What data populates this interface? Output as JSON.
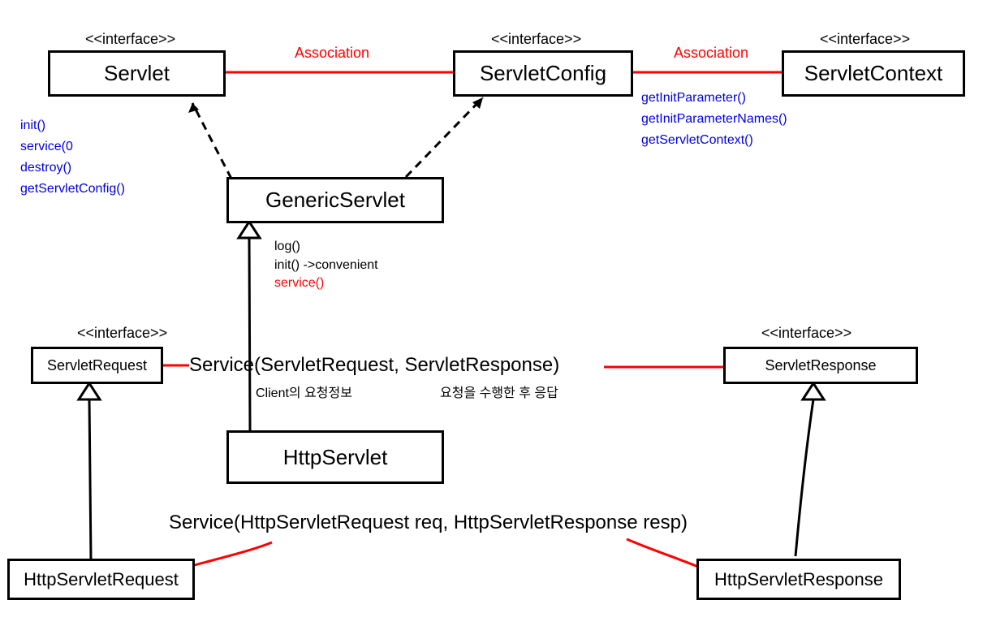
{
  "stereotypes": {
    "servlet": "<<interface>>",
    "servletConfig": "<<interface>>",
    "servletContext": "<<interface>>",
    "servletRequest": "<<interface>>",
    "servletResponse": "<<interface>>"
  },
  "boxes": {
    "servlet": "Servlet",
    "servletConfig": "ServletConfig",
    "servletContext": "ServletContext",
    "genericServlet": "GenericServlet",
    "servletRequest": "ServletRequest",
    "servletResponse": "ServletResponse",
    "httpServlet": "HttpServlet",
    "httpServletRequest": "HttpServletRequest",
    "httpServletResponse": "HttpServletResponse"
  },
  "servletMethods": {
    "m1": "init()",
    "m2": "service(0",
    "m3": "destroy()",
    "m4": "getServletConfig()"
  },
  "configMethods": {
    "m1": "getInitParameter()",
    "m2": "getInitParameterNames()",
    "m3": "getServletContext()"
  },
  "genericMethods": {
    "m1": "log()",
    "m2": "init() ->convenient",
    "m3": "service()"
  },
  "assoc": {
    "a1": "Association",
    "a2": "Association"
  },
  "signatures": {
    "s1": "Service(ServletRequest, ServletResponse)",
    "s2": "Service(HttpServletRequest req, HttpServletResponse resp)"
  },
  "notes": {
    "n1": "Client의 요청정보",
    "n2": "요청을 수행한 후 응답"
  }
}
